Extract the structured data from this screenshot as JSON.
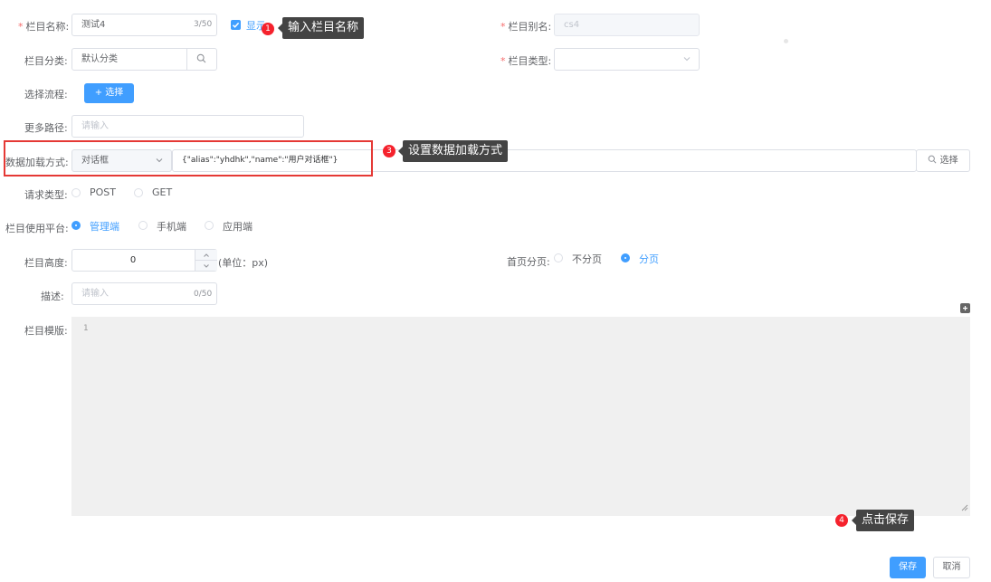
{
  "form": {
    "name": {
      "label": "栏目名称:",
      "value": "测试4",
      "counter": "3/50",
      "show_label": "显示"
    },
    "alias": {
      "label": "栏目别名:",
      "value": "cs4"
    },
    "category": {
      "label": "栏目分类:",
      "value": "默认分类"
    },
    "type": {
      "label": "栏目类型:",
      "value": ""
    },
    "flow": {
      "label": "选择流程:",
      "button": "+ 选择"
    },
    "more_path": {
      "label": "更多路径:",
      "placeholder": "请输入"
    },
    "load_mode": {
      "label": "数据加载方式:",
      "select_value": "对话框",
      "text_value": "{\"alias\":\"yhdhk\",\"name\":\"用户对话框\"}",
      "select_button": "选择"
    },
    "request_type": {
      "label": "请求类型:",
      "options": [
        "POST",
        "GET"
      ]
    },
    "platform": {
      "label": "栏目使用平台:",
      "options": [
        "管理端",
        "手机端",
        "应用端"
      ]
    },
    "height": {
      "label": "栏目高度:",
      "value": "0",
      "unit": "(单位：px)"
    },
    "paging": {
      "label": "首页分页:",
      "options": [
        "不分页",
        "分页"
      ]
    },
    "desc": {
      "label": "描述:",
      "placeholder": "请输入",
      "counter": "0/50"
    },
    "template": {
      "label": "栏目模版:",
      "line_number": "1"
    }
  },
  "annotations": {
    "a1": {
      "num": "1",
      "text": "输入栏目名称"
    },
    "a3": {
      "num": "3",
      "text": "设置数据加载方式"
    },
    "a4": {
      "num": "4",
      "text": "点击保存"
    }
  },
  "footer": {
    "save": "保存",
    "cancel": "取消"
  },
  "colors": {
    "primary": "#409eff",
    "required": "#f56c6c",
    "annotation_red": "#f5222d",
    "highlight_box": "#e53935"
  }
}
